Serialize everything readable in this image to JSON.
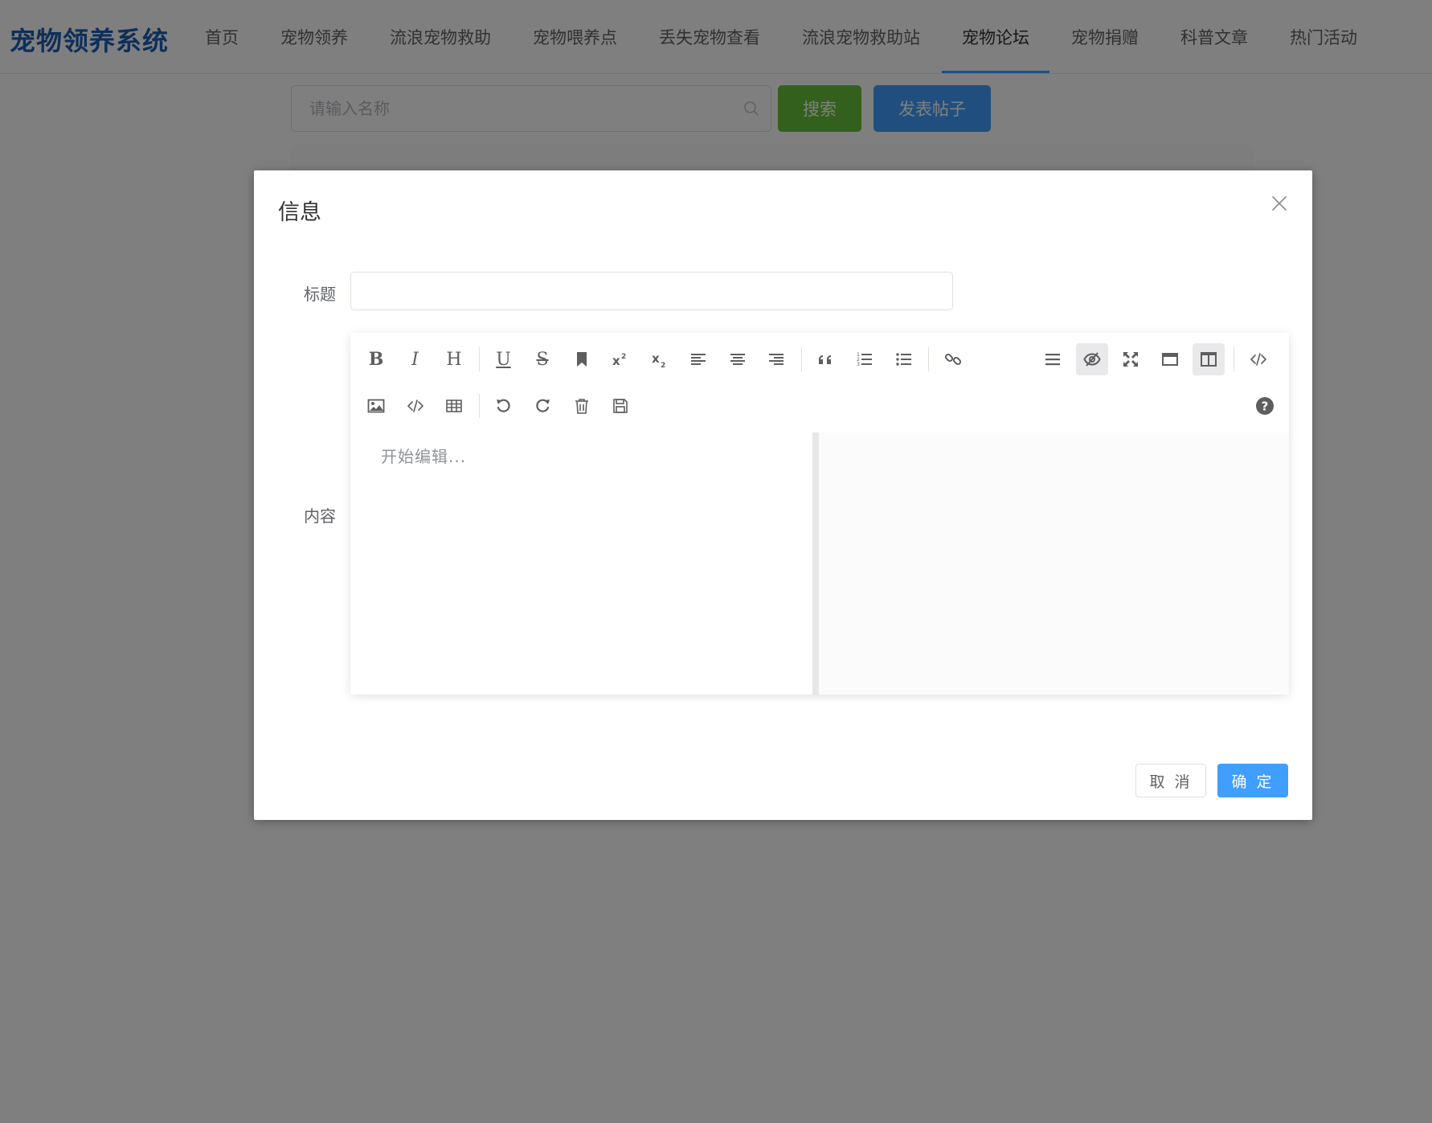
{
  "app": {
    "brand": "宠物领养系统"
  },
  "nav": {
    "items": [
      {
        "label": "首页"
      },
      {
        "label": "宠物领养"
      },
      {
        "label": "流浪宠物救助"
      },
      {
        "label": "宠物喂养点"
      },
      {
        "label": "丢失宠物查看"
      },
      {
        "label": "流浪宠物救助站"
      },
      {
        "label": "宠物论坛",
        "active": true
      },
      {
        "label": "宠物捐赠"
      },
      {
        "label": "科普文章"
      },
      {
        "label": "热门活动"
      }
    ]
  },
  "toolbar": {
    "search_placeholder": "请输入名称",
    "search_label": "搜索",
    "post_label": "发表帖子"
  },
  "dialog": {
    "title": "信息",
    "title_label": "标题",
    "title_value": "",
    "content_label": "内容",
    "editor_placeholder": "开始编辑...",
    "cancel_label": "取 消",
    "ok_label": "确 定"
  },
  "editor_toolbar": {
    "row1_left": [
      "bold-icon",
      "italic-icon",
      "header-icon",
      "underline-icon",
      "strikethrough-icon",
      "mark-icon",
      "superscript-icon",
      "subscript-icon",
      "align-left-icon",
      "align-center-icon",
      "align-right-icon",
      "quote-icon",
      "ordered-list-icon",
      "unordered-list-icon",
      "link-icon"
    ],
    "row1_right": [
      "navigation-icon",
      "preview-toggle-icon",
      "fullscreen-icon",
      "read-mode-icon",
      "split-view-icon",
      "html-code-icon"
    ],
    "row2": [
      "image-icon",
      "code-icon",
      "table-icon",
      "undo-icon",
      "redo-icon",
      "trash-icon",
      "save-icon"
    ],
    "help": "help-icon"
  },
  "colors": {
    "brand": "#1c5fb3",
    "primary": "#409eff",
    "success": "#67c23a"
  }
}
